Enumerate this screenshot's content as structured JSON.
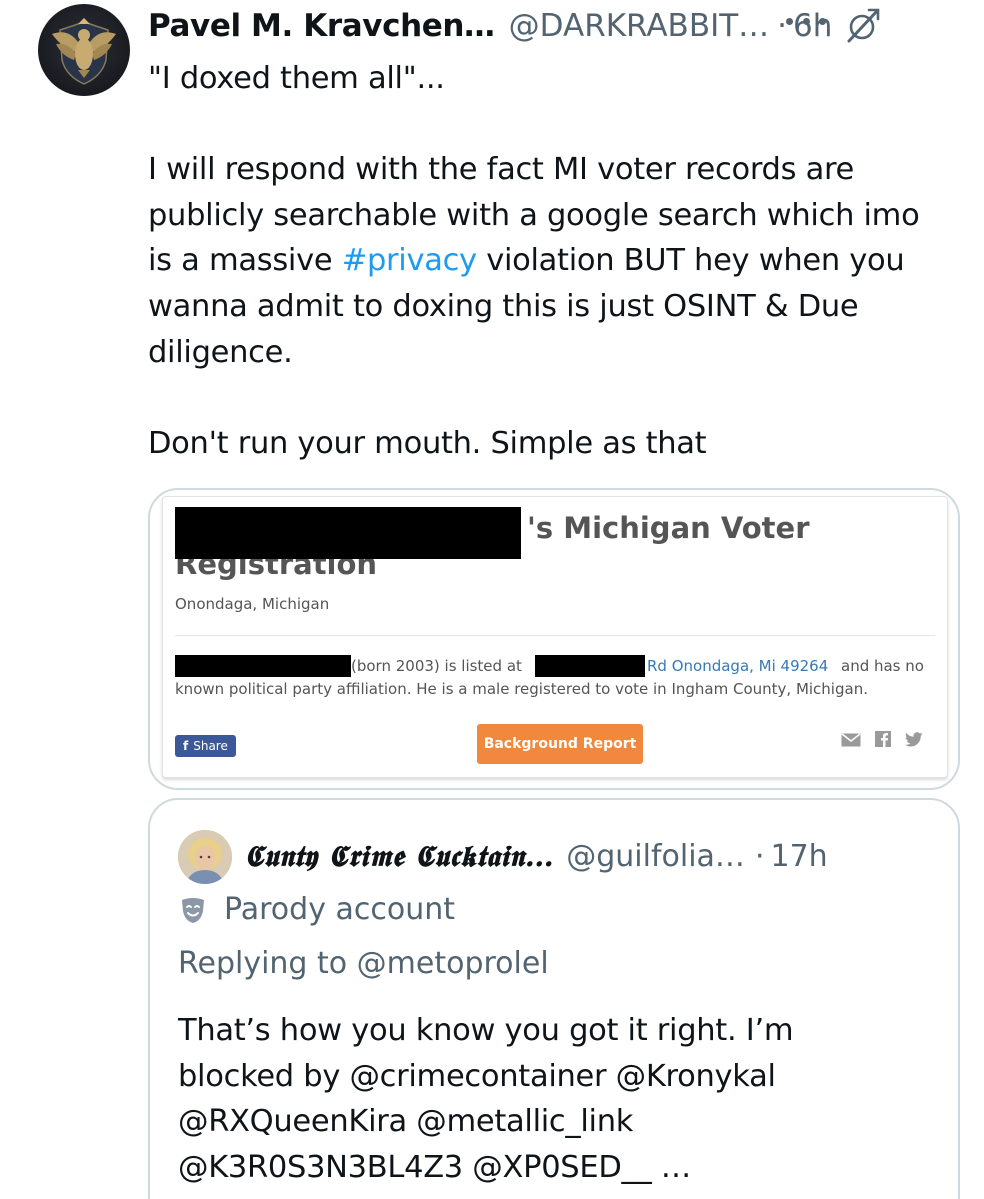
{
  "tweet": {
    "display_name": "Pavel M. Kravchen…",
    "handle": "@DARKRABBIT…",
    "separator": "·",
    "time": "6h",
    "text_line1": "\"I doxed them all\"...",
    "text_p2_l1": "I will respond with the fact MI voter records are",
    "text_p2_l2": "publicly searchable with a google search which imo",
    "text_p2_l3_pre": "is a massive ",
    "hashtag": "#privacy",
    "text_p2_l3_post": " violation BUT hey when you",
    "text_p2_l4": "wanna admit to doxing this is just OSINT & Due",
    "text_p2_l5": "diligence.",
    "text_p3": "Don't run your mouth. Simple as that"
  },
  "embedded_image": {
    "title_part1": "'s Michigan Voter",
    "title_part2": "Registration",
    "location": "Onondaga, Michigan",
    "desc_a": "(born 2003) is listed at",
    "desc_link": "Rd Onondaga, Mi 49264",
    "desc_c": "and has no",
    "desc_line2": "known political party affiliation. He is a male registered to vote in Ingham County, Michigan.",
    "share_label": "Share",
    "share_icon_glyph": "f",
    "report_label": "Background Report"
  },
  "quoted": {
    "display_name": "𝕮𝖚𝖓𝖙𝖞 𝕮𝖗𝖎𝖒𝖊 𝕮𝖚𝖈𝖐𝖙𝖆𝖎𝖓…",
    "handle": "@guilfolia…",
    "separator": "·",
    "time": "17h",
    "parody_label": "Parody account",
    "replying_to": "Replying to @metoprolel",
    "text_l1": "That’s how you know you got it right. I’m",
    "text_l2": "blocked by @crimecontainer @Kronykal",
    "text_l3": "@RXQueenKira @metallic_link",
    "text_l4": "@K3R0S3N3BL4Z3 @XP0SED__ …"
  },
  "icons": {
    "avatar": "eagle-crest-avatar",
    "verified": "verified-org-icon",
    "more": "more-icon",
    "parody": "theater-mask-icon",
    "share_row": [
      "email-icon",
      "facebook-icon",
      "twitter-icon"
    ]
  },
  "colors": {
    "link": "#1d9bf0",
    "muted": "#536471",
    "text": "#0f1419",
    "border": "#cfd9de",
    "report_button": "#f0883e",
    "facebook": "#3b5998"
  }
}
